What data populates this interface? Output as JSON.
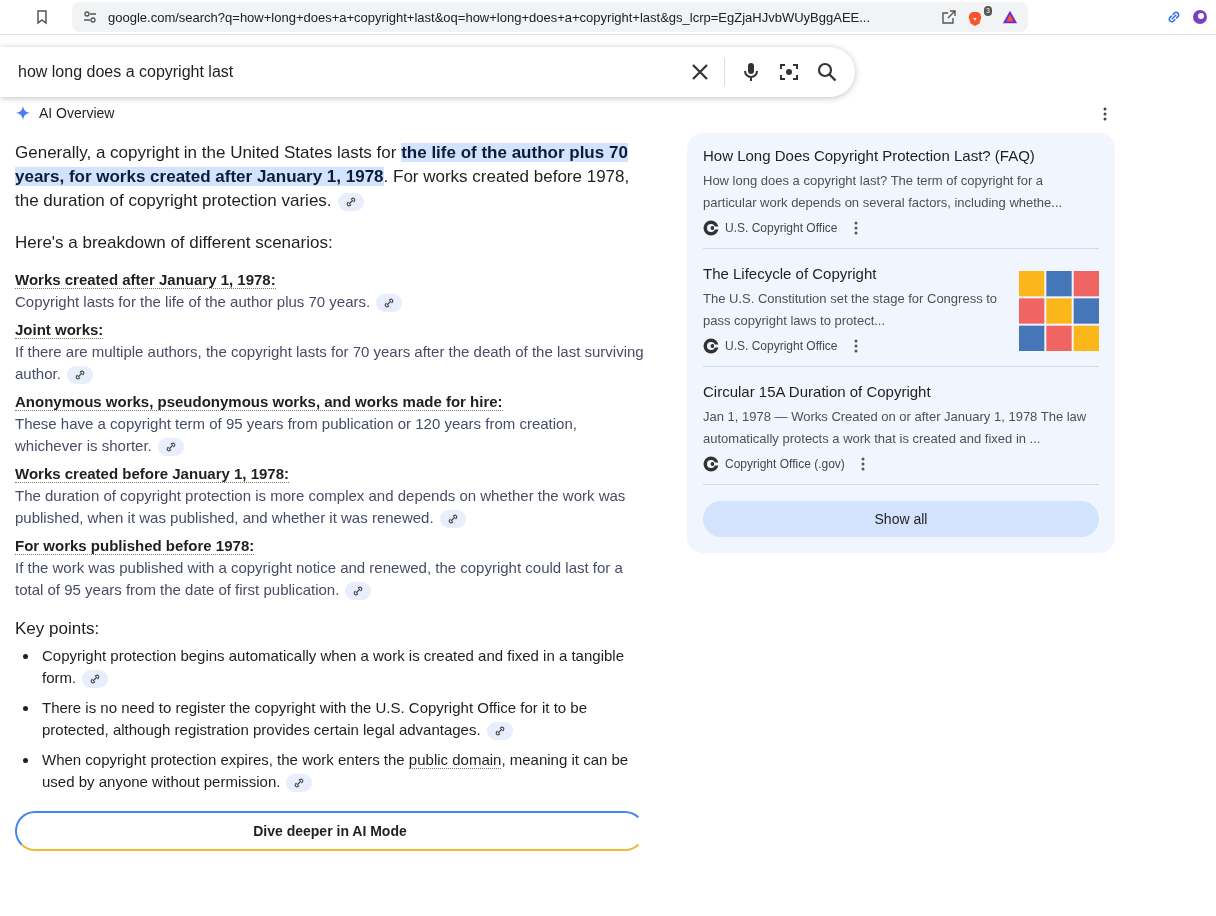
{
  "browser": {
    "url": "google.com/search?q=how+long+does+a+copyright+last&oq=how+long+does+a+copyright+last&gs_lcrp=EgZjaHJvbWUyBggAEE...",
    "shields_count": "3"
  },
  "search": {
    "value": "how long does a copyright last"
  },
  "overview": {
    "title": "AI Overview",
    "intro": [
      {
        "text": "Generally, a copyright in the United States lasts for ",
        "highlighted": false
      },
      {
        "text": "the life of the author plus 70 years, for works created after January 1, 1978",
        "highlighted": true
      },
      {
        "text": ". For works created before 1978, the duration of copyright protection varies.",
        "highlighted": false
      }
    ],
    "breakdown_heading": "Here's a breakdown of different scenarios:",
    "scenarios": [
      {
        "heading": "Works created after January 1, 1978:",
        "text": "Copyright lasts for the life of the author plus 70 years."
      },
      {
        "heading": "Joint works:",
        "text": "If there are multiple authors, the copyright lasts for 70 years after the death of the last surviving author."
      },
      {
        "heading": "Anonymous works, pseudonymous works, and works made for hire:",
        "text": "These have a copyright term of 95 years from publication or 120 years from creation, whichever is shorter."
      },
      {
        "heading": "Works created before January 1, 1978:",
        "text": "The duration of copyright protection is more complex and depends on whether the work was published, when it was published, and whether it was renewed."
      },
      {
        "heading": "For works published before 1978:",
        "text": "If the work was published with a copyright notice and renewed, the copyright could last for a total of 95 years from the date of first publication."
      }
    ],
    "key_points_heading": "Key points:",
    "key_points": [
      [
        {
          "text": "Copyright protection begins automatically when a work is created and fixed in a tangible form.",
          "underlined": false
        }
      ],
      [
        {
          "text": "There is no need to register the copyright with the U.S. Copyright Office for it to be protected, although registration provides certain legal advantages.",
          "underlined": false
        }
      ],
      [
        {
          "text": "When copyright protection expires, the work enters the ",
          "underlined": false
        },
        {
          "text": "public domain",
          "underlined": true
        },
        {
          "text": ", meaning it can be used by anyone without permission.",
          "underlined": false
        }
      ]
    ],
    "dive_button": "Dive deeper in AI Mode"
  },
  "sources": {
    "items": [
      {
        "title": "How Long Does Copyright Protection Last? (FAQ)",
        "snippet": "How long does a copyright last? The term of copyright for a particular work depends on several factors, including whethe...",
        "site": "U.S. Copyright Office",
        "thumbnail": false
      },
      {
        "title": "The Lifecycle of Copyright",
        "snippet": "The U.S. Constitution set the stage for Congress to pass copyright laws to protect...",
        "site": "U.S. Copyright Office",
        "thumbnail": true
      },
      {
        "title": "Circular 15A Duration of Copyright",
        "snippet": "Jan 1, 1978 — Works Created on or after January 1, 1978 The law automatically protects a work that is created and fixed in ...",
        "site": "Copyright Office (.gov)",
        "thumbnail": false
      }
    ],
    "show_all": "Show all"
  }
}
